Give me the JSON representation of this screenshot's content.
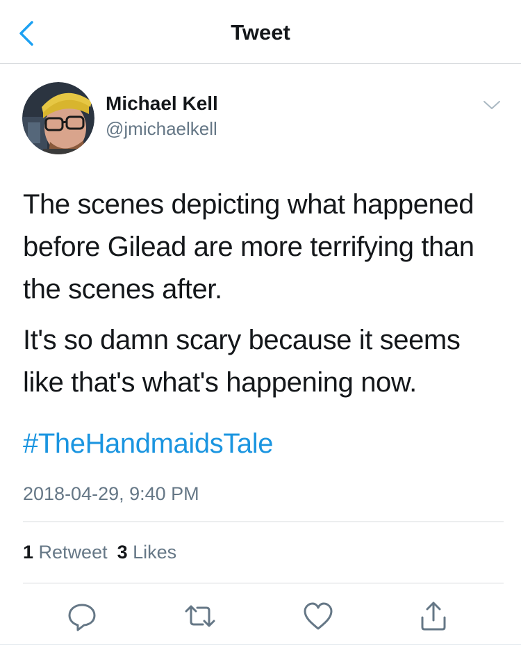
{
  "nav": {
    "title": "Tweet",
    "back_icon": "chevron-left-icon"
  },
  "author": {
    "name": "Michael Kell",
    "handle": "@jmichaelkell"
  },
  "tweet": {
    "paragraphs": [
      "The scenes depicting what happened before Gilead are more terrifying than the scenes after.",
      "It's so damn scary because it seems like that's what's happening now."
    ],
    "hashtag": "#TheHandmaidsTale",
    "timestamp": "2018-04-29, 9:40 PM"
  },
  "stats": {
    "retweet_count": "1",
    "retweet_label": "Retweet",
    "like_count": "3",
    "like_label": "Likes"
  },
  "actions": [
    "reply-icon",
    "retweet-icon",
    "heart-icon",
    "share-icon"
  ],
  "colors": {
    "accent": "#1da1f2",
    "hashtag": "#1b95e0",
    "secondary_text": "#657786",
    "primary_text": "#14171a",
    "divider": "#d6d9dc"
  }
}
